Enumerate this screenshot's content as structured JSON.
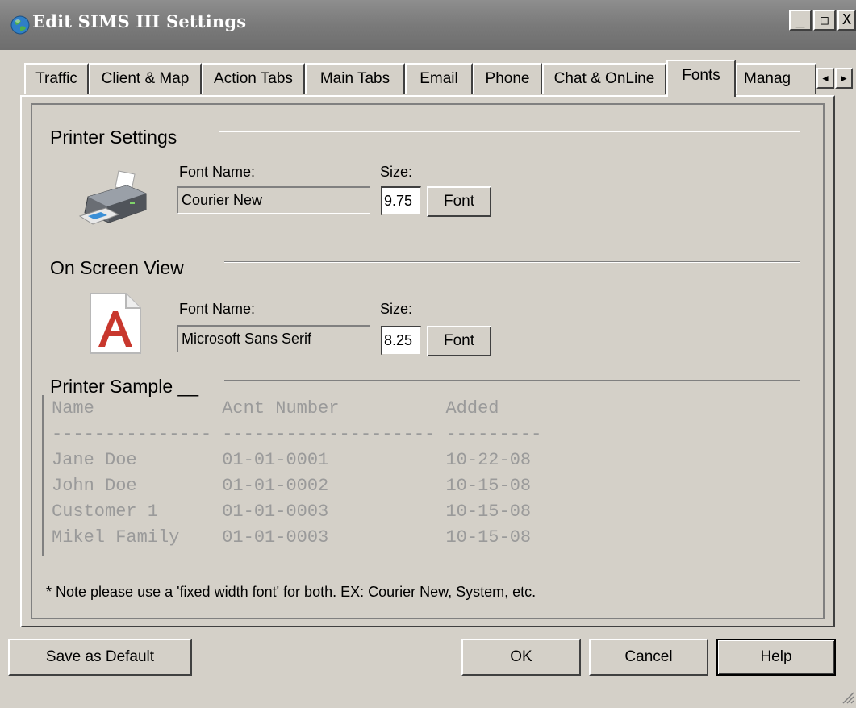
{
  "window": {
    "title": "Edit SIMS III Settings",
    "controls": {
      "minimize": "_",
      "maximize": "□",
      "close": "X"
    }
  },
  "tabs": [
    {
      "label": "Traffic",
      "active": false
    },
    {
      "label": "Client & Map",
      "active": false
    },
    {
      "label": "Action Tabs",
      "active": false
    },
    {
      "label": "Main Tabs",
      "active": false
    },
    {
      "label": "Email",
      "active": false
    },
    {
      "label": "Phone",
      "active": false
    },
    {
      "label": "Chat & OnLine",
      "active": false
    },
    {
      "label": "Fonts",
      "active": true
    },
    {
      "label": "Manag",
      "active": false
    }
  ],
  "tab_scroll": {
    "left": "◄",
    "right": "►"
  },
  "printer_settings": {
    "group_title": "Printer Settings",
    "font_name_label": "Font Name:",
    "font_name_value": "Courier New",
    "size_label": "Size:",
    "size_value": "9.75",
    "font_button": "Font",
    "icon": "printer-icon"
  },
  "on_screen_view": {
    "group_title": "On Screen View",
    "font_name_label": "Font Name:",
    "font_name_value": "Microsoft Sans Serif",
    "size_label": "Size:",
    "size_value": "8.25",
    "font_button": "Font",
    "icon": "font-file-icon"
  },
  "printer_sample": {
    "group_title": "Printer Sample __",
    "lines": [
      "Name            Acnt Number          Added",
      "--------------- -------------------- ---------",
      "Jane Doe        01-01-0001           10-22-08",
      "John Doe        01-01-0002           10-15-08",
      "Customer 1      01-01-0003           10-15-08",
      "Mikel Family    01-01-0003           10-15-08"
    ]
  },
  "note": "* Note please use a 'fixed width font' for both. EX: Courier New, System, etc.",
  "footer": {
    "save_default": "Save as Default",
    "ok": "OK",
    "cancel": "Cancel",
    "help": "Help"
  },
  "colors": {
    "dialog_bg": "#d4d0c8",
    "title_bar": "#7a7a7a",
    "sample_text": "#9a9a9a",
    "acrobat_red": "#c8372d"
  }
}
